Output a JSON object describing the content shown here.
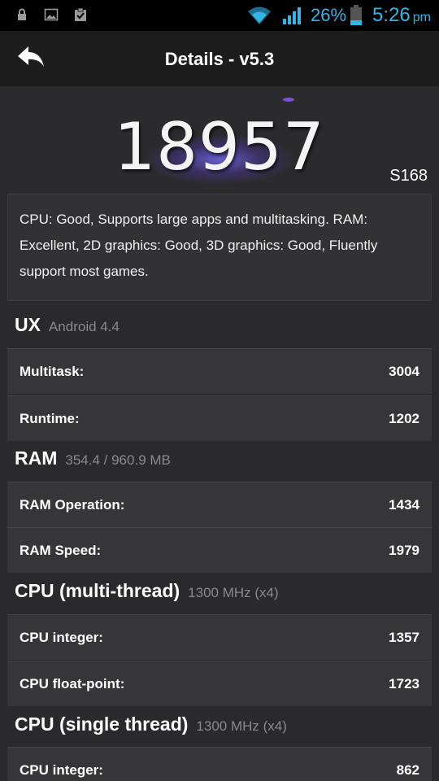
{
  "status_bar": {
    "icons_left": [
      "lock-icon",
      "image-icon",
      "clipboard-check-icon"
    ],
    "icons_right": [
      "wifi-icon",
      "signal-icon",
      "battery-icon"
    ],
    "battery": "26%",
    "time": "5:26",
    "ampm": "pm",
    "accent": "#33b5e5"
  },
  "header": {
    "title": "Details - v5.3",
    "back_icon": "back-arrow-icon"
  },
  "score": {
    "total": "18957",
    "device": "S168"
  },
  "summary": "CPU: Good, Supports large apps and multitasking. RAM: Excellent, 2D graphics: Good, 3D graphics: Good, Fluently support most games.",
  "sections": [
    {
      "title": "UX",
      "sub": "Android 4.4",
      "rows": [
        {
          "label": "Multitask:",
          "value": "3004"
        },
        {
          "label": "Runtime:",
          "value": "1202"
        }
      ]
    },
    {
      "title": "RAM",
      "sub": "354.4 / 960.9 MB",
      "rows": [
        {
          "label": "RAM Operation:",
          "value": "1434"
        },
        {
          "label": "RAM Speed:",
          "value": "1979"
        }
      ]
    },
    {
      "title": "CPU (multi-thread)",
      "sub": "1300 MHz (x4)",
      "rows": [
        {
          "label": "CPU integer:",
          "value": "1357"
        },
        {
          "label": "CPU float-point:",
          "value": "1723"
        }
      ]
    },
    {
      "title": "CPU (single thread)",
      "sub": "1300 MHz (x4)",
      "rows": [
        {
          "label": "CPU integer:",
          "value": "862"
        }
      ]
    }
  ]
}
